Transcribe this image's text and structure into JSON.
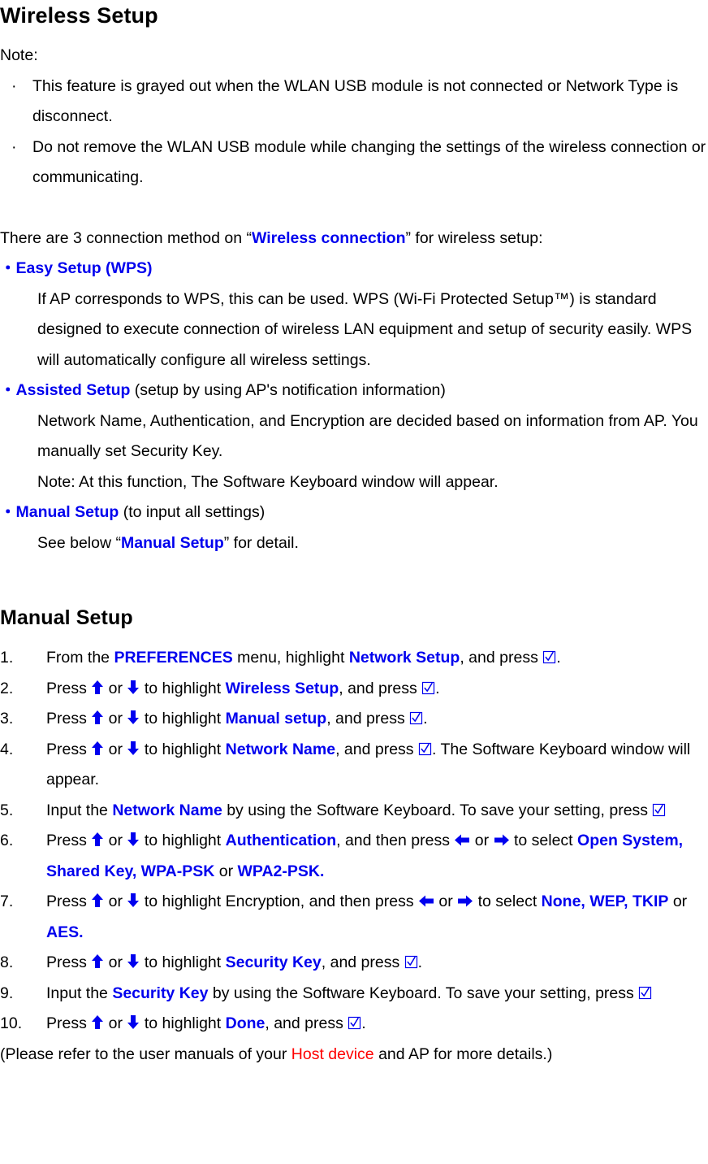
{
  "colors": {
    "blue": "#0000ee",
    "red": "#ff0000",
    "black": "#000000"
  },
  "heading": "Wireless Setup",
  "note": {
    "label": "Note:",
    "bullet_glyph": "·",
    "items": [
      "This feature is grayed out when the WLAN USB module is not connected or Network Type is disconnect.",
      "Do not remove the WLAN USB module while changing the settings of the wireless connection or communicating."
    ]
  },
  "intro": {
    "before": "There are 3 connection method on “",
    "link": "Wireless connection",
    "after": "” for wireless setup:"
  },
  "methods": {
    "bullet_glyph": "・",
    "items": [
      {
        "title": "Easy Setup (WPS)",
        "title_suffix": "",
        "description": "If AP corresponds to WPS, this can be used. WPS (Wi-Fi Protected Setup™) is standard designed to execute connection of wireless LAN equipment and setup of security easily. WPS will automatically configure all wireless settings."
      },
      {
        "title": "Assisted Setup",
        "title_suffix": " (setup by using AP's notification information)",
        "description": "Network Name, Authentication, and Encryption are decided based on information from AP. You manually set Security Key.",
        "description2": "Note: At this function, The Software Keyboard window will appear."
      },
      {
        "title": "Manual Setup",
        "title_suffix": " (to input all settings)",
        "description_before": "See below “",
        "description_link": "Manual Setup",
        "description_after": "” for detail."
      }
    ]
  },
  "manual_setup": {
    "heading": "Manual Setup",
    "steps": [
      {
        "num": "1.",
        "text": "From the PREFERENCES menu, highlight Network Setup, and press ☑."
      },
      {
        "num": "2.",
        "text": "Press ↑ or ↓ to highlight Wireless Setup, and press ☑."
      },
      {
        "num": "3.",
        "text": "Press ↑ or ↓ to highlight Manual setup, and press ☑."
      },
      {
        "num": "4.",
        "text": "Press ↑ or ↓ to highlight Network Name, and press ☑. The Software Keyboard window will appear."
      },
      {
        "num": "5.",
        "text": "Input the Network Name by using the Software Keyboard. To save your setting, press ☑"
      },
      {
        "num": "6.",
        "text": "Press ↑ or ↓ to highlight Authentication, and then press ← or → to select Open System, Shared Key, WPA-PSK or WPA2-PSK."
      },
      {
        "num": "7.",
        "text": "Press ↑ or ↓ to highlight Encryption, and then press ← or → to select None, WEP, TKIP or AES."
      },
      {
        "num": "8.",
        "text": "Press ↑ or ↓ to highlight Security Key, and press ☑."
      },
      {
        "num": "9.",
        "text": "Input the Security Key by using the Software Keyboard. To save your setting, press ☑"
      },
      {
        "num": "10.",
        "text": "Press ↑ or ↓ to highlight Done, and press ☑."
      }
    ],
    "step_fragments": {
      "s1": {
        "a": "From the ",
        "b1": "PREFERENCES",
        "c": " menu, highlight ",
        "b2": "Network Setup",
        "d": ", and press ",
        "e": "."
      },
      "s2": {
        "a": "Press ",
        "c": " or ",
        "d": " to highlight ",
        "b": "Wireless Setup",
        "e": ", and press ",
        "f": "."
      },
      "s3": {
        "b": "Manual setup"
      },
      "s4": {
        "b": "Network Name",
        "tail": ". The Software Keyboard window will appear."
      },
      "s5": {
        "a": "Input the ",
        "b": "Network Name",
        "c": " by using the Software Keyboard. To save your setting, press "
      },
      "s6": {
        "b": "Authentication",
        "mid": ", and then press ",
        "sel": " to select ",
        "o1": "Open System, Shared Key, WPA-PSK",
        "or": " or ",
        "o2": "WPA2-PSK."
      },
      "s7": {
        "b": "Encryption",
        "mid": ", and then press ",
        "sel": " to select ",
        "o1": "None, WEP, TKIP",
        "or": " or ",
        "o2": "AES."
      },
      "s8": {
        "b": "Security Key"
      },
      "s9": {
        "a": "Input the ",
        "b": "Security Key",
        "c": " by using the Software Keyboard. To save your setting, press "
      },
      "s10": {
        "b": "Done"
      },
      "common": {
        "press": "Press ",
        "or": " or ",
        "to_highlight": " to highlight ",
        "and_press": ", and press ",
        "period": "."
      }
    }
  },
  "closing": {
    "before": "(Please refer to the user manuals of your ",
    "red": "Host device",
    "after": " and AP for more details.)"
  },
  "icons": {
    "arrow_up": "arrow-up-icon",
    "arrow_down": "arrow-down-icon",
    "arrow_left": "arrow-left-icon",
    "arrow_right": "arrow-right-icon",
    "checkbox_checked": "checkbox-checked-icon"
  }
}
